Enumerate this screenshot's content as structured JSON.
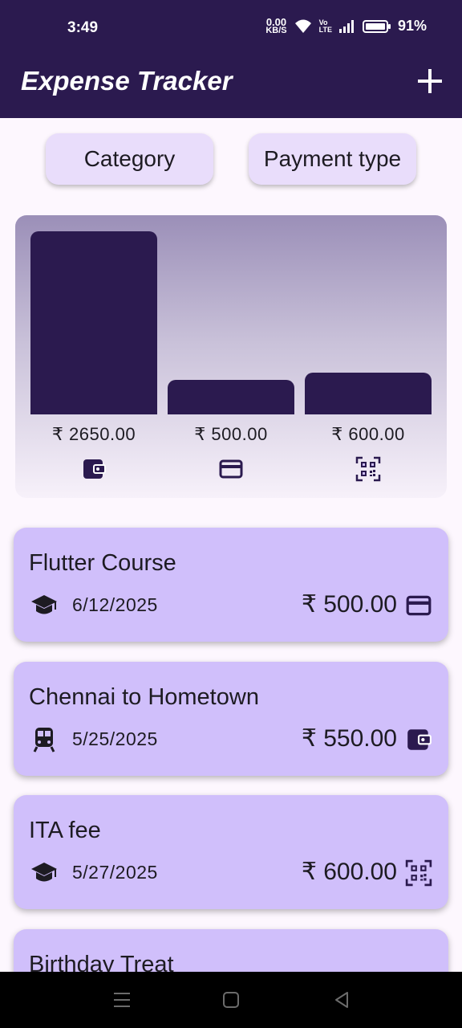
{
  "status": {
    "time": "3:49",
    "net_speed_value": "0.00",
    "net_speed_unit": "KB/S",
    "volte_top": "Vo",
    "volte_bottom": "LTE",
    "battery": "91%"
  },
  "appbar": {
    "title": "Expense Tracker",
    "add_icon": "plus-icon"
  },
  "filters": {
    "category_label": "Category",
    "payment_label": "Payment type"
  },
  "chart_data": {
    "type": "bar",
    "categories": [
      "wallet",
      "card",
      "qr-code"
    ],
    "labels": [
      "₹ 2650.00",
      "₹ 500.00",
      "₹ 600.00"
    ],
    "values": [
      2650,
      500,
      600
    ],
    "icons": [
      "wallet-icon",
      "credit-card-icon",
      "qr-code-icon"
    ],
    "ylim": [
      0,
      2650
    ],
    "bar_color": "#2b1a4f"
  },
  "expenses": [
    {
      "title": "Flutter Course",
      "date": "6/12/2025",
      "amount": "₹ 500.00",
      "category_icon": "graduation-cap-icon",
      "payment_icon": "credit-card-icon"
    },
    {
      "title": "Chennai to Hometown",
      "date": "5/25/2025",
      "amount": "₹ 550.00",
      "category_icon": "train-icon",
      "payment_icon": "wallet-icon"
    },
    {
      "title": "ITA fee",
      "date": "5/27/2025",
      "amount": "₹ 600.00",
      "category_icon": "graduation-cap-icon",
      "payment_icon": "qr-code-icon"
    },
    {
      "title": "Birthday Treat"
    }
  ],
  "colors": {
    "primary": "#2b1a4f",
    "card": "#d0bffb",
    "chip": "#e9ddfb",
    "background": "#fdf7fe"
  }
}
